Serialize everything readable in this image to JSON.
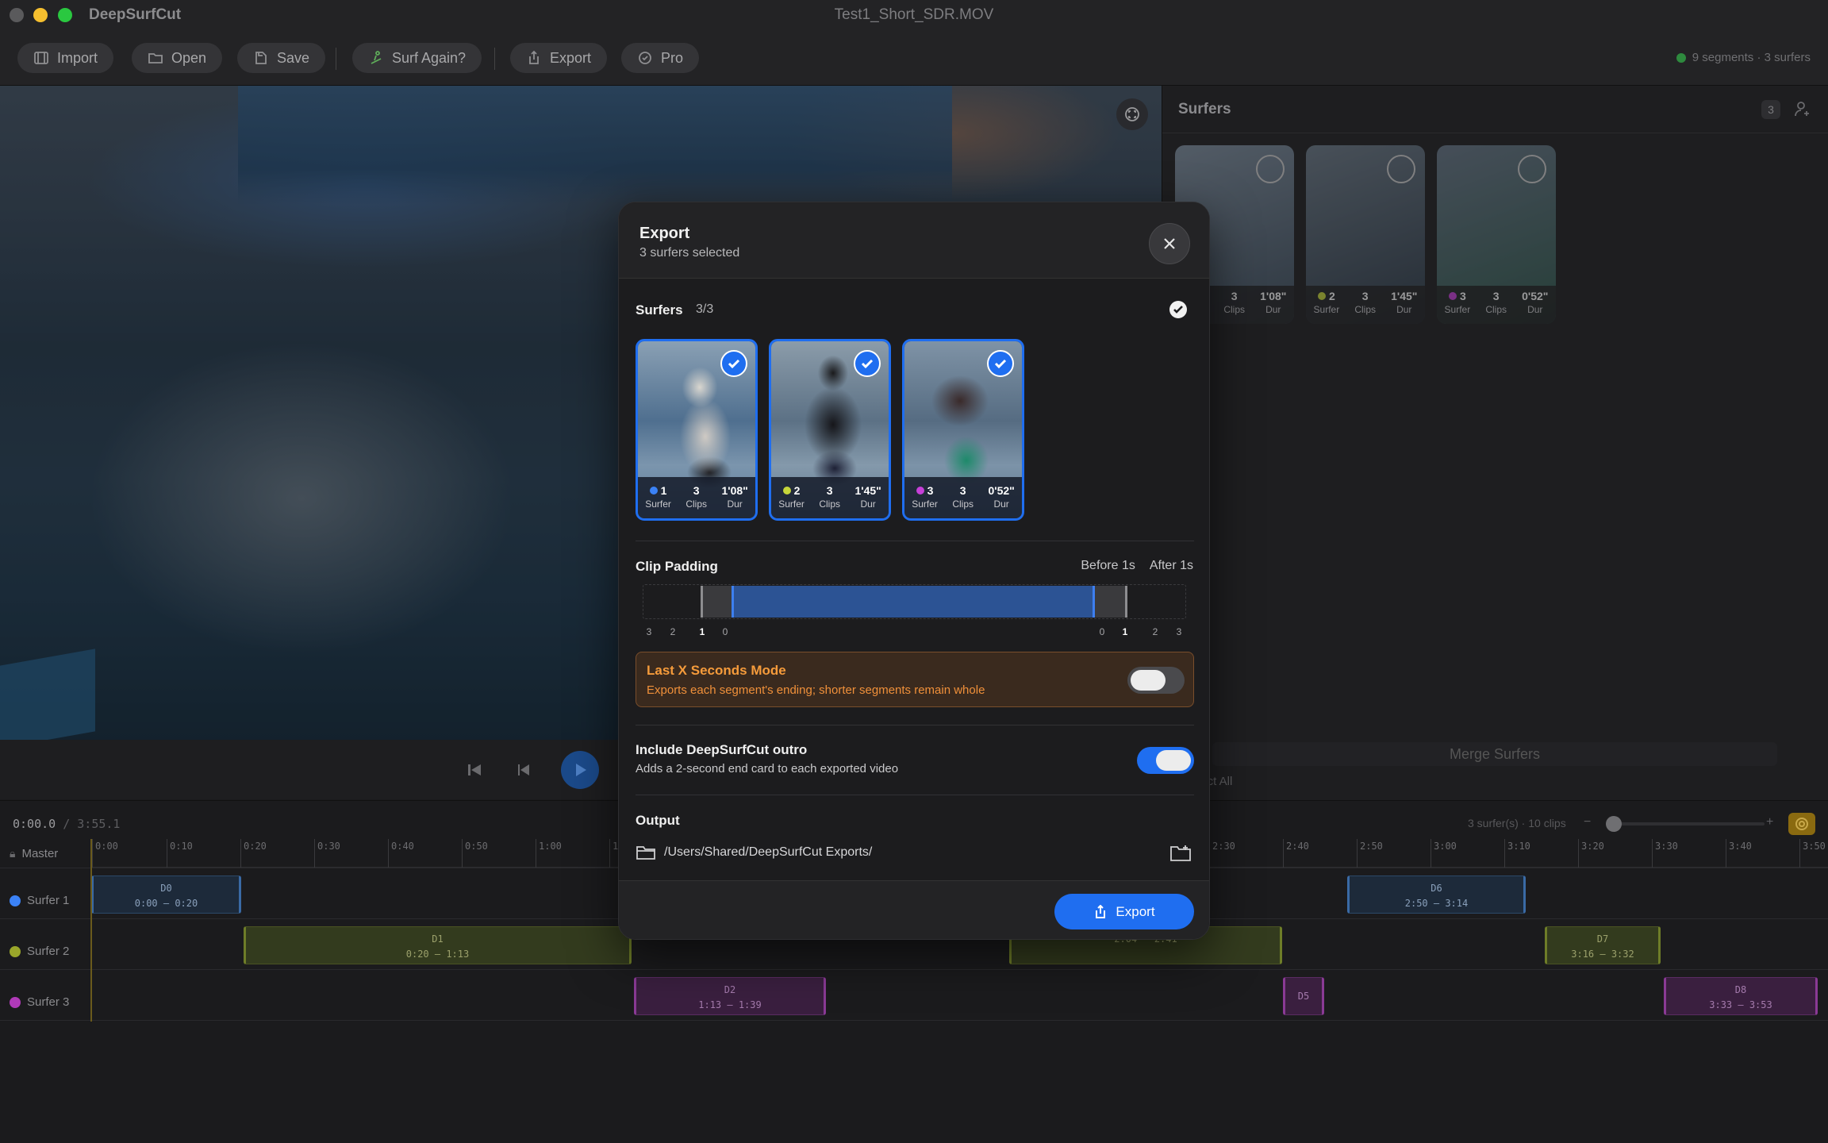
{
  "window": {
    "app_name": "DeepSurfCut",
    "document_title": "Test1_Short_SDR.MOV"
  },
  "toolbar": {
    "buttons": [
      {
        "label": "Import",
        "icon": "film-icon"
      },
      {
        "label": "Open",
        "icon": "folder-icon"
      },
      {
        "label": "Save",
        "icon": "save-icon"
      },
      {
        "label": "Surf Again?",
        "icon": "surfer-icon"
      },
      {
        "label": "Export",
        "icon": "share-icon"
      },
      {
        "label": "Pro",
        "icon": "badge-icon"
      }
    ],
    "status": "9 segments · 3 surfers"
  },
  "side_panel": {
    "title": "Surfers",
    "count": "3",
    "surfers": [
      {
        "number": "1",
        "clips": "3",
        "duration": "1'08\"",
        "color": "#3b82f6"
      },
      {
        "number": "2",
        "clips": "3",
        "duration": "1'45\"",
        "color": "#c6d63a"
      },
      {
        "number": "3",
        "clips": "3",
        "duration": "0'52\"",
        "color": "#c640d8"
      }
    ],
    "stat_labels": {
      "surfer": "Surfer",
      "clips": "Clips",
      "duration": "Dur"
    },
    "merge_label": "Merge Surfers",
    "select_all_label": "lect All"
  },
  "timeline": {
    "current_time": "0:00.0",
    "separator": "/",
    "total_time": "3:55.1",
    "info": "3 surfer(s) · 10 clips",
    "ticks": [
      "0:00",
      "0:10",
      "0:20",
      "0:30",
      "0:40",
      "0:50",
      "1:00",
      "1:",
      "2:30",
      "2:40",
      "2:50",
      "3:00",
      "3:10",
      "3:20",
      "3:30",
      "3:40",
      "3:50"
    ],
    "tracks": [
      {
        "label": "Master",
        "icon": "lock-icon"
      },
      {
        "label": "Surfer 1",
        "color": "#3b82f6"
      },
      {
        "label": "Surfer 2",
        "color": "#9aa62a"
      },
      {
        "label": "Surfer 3",
        "color": "#b03ab8"
      }
    ],
    "clips": [
      {
        "id": "D0",
        "range": "0:00 — 0:20",
        "track": 1
      },
      {
        "id": "D6",
        "range": "2:50 — 3:14",
        "track": 1
      },
      {
        "id": "D1",
        "range": "0:20 — 1:13",
        "track": 2
      },
      {
        "id": "",
        "range": "2:04 — 2:41",
        "track": 2
      },
      {
        "id": "D7",
        "range": "3:16 — 3:32",
        "track": 2
      },
      {
        "id": "D2",
        "range": "1:13 — 1:39",
        "track": 3
      },
      {
        "id": "D5",
        "range": "",
        "track": 3
      },
      {
        "id": "D8",
        "range": "3:33 — 3:53",
        "track": 3
      }
    ]
  },
  "modal": {
    "title": "Export",
    "subtitle": "3 surfers selected",
    "surfers_label": "Surfers",
    "surfers_count": "3/3",
    "clip_padding_label": "Clip Padding",
    "before_label": "Before 1s",
    "after_label": "After 1s",
    "padding_ticks": [
      "3",
      "2",
      "1",
      "0",
      "0",
      "1",
      "2",
      "3"
    ],
    "last_x_title": "Last X Seconds Mode",
    "last_x_desc": "Exports each segment's ending; shorter segments remain whole",
    "last_x_enabled": false,
    "outro_title": "Include DeepSurfCut outro",
    "outro_desc": "Adds a 2-second end card to each exported video",
    "outro_enabled": true,
    "output_label": "Output",
    "output_path": "/Users/Shared/DeepSurfCut Exports/",
    "export_button": "Export",
    "accent": "#1f6ef0",
    "warning_color": "#f59b3b"
  }
}
